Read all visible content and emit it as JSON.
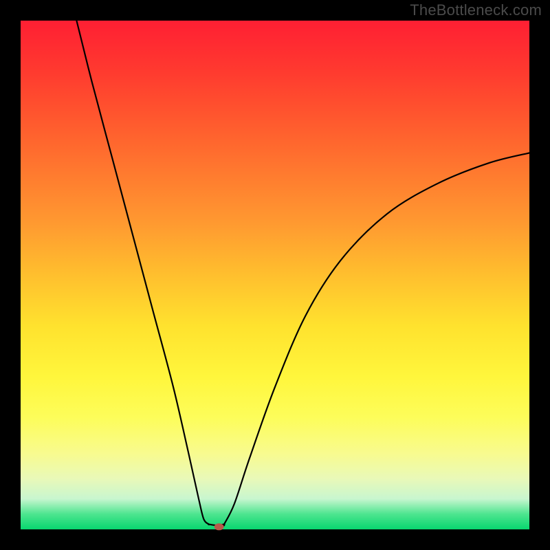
{
  "watermark": "TheBottleneck.com",
  "chart_data": {
    "type": "line",
    "title": "",
    "xlabel": "",
    "ylabel": "",
    "xlim": [
      0,
      100
    ],
    "ylim": [
      0,
      100
    ],
    "grid": false,
    "legend": false,
    "series": [
      {
        "name": "left-branch",
        "x": [
          11,
          14,
          18,
          22,
          26,
          30,
          33,
          35,
          36,
          37
        ],
        "y": [
          100,
          88,
          73,
          58,
          43,
          28,
          15,
          6,
          2,
          1
        ]
      },
      {
        "name": "valley",
        "x": [
          37,
          38.5,
          40
        ],
        "y": [
          1,
          0.8,
          1
        ]
      },
      {
        "name": "right-branch",
        "x": [
          40,
          42,
          45,
          50,
          56,
          63,
          72,
          82,
          92,
          100
        ],
        "y": [
          1,
          5,
          14,
          28,
          42,
          53,
          62,
          68,
          72,
          74
        ]
      }
    ],
    "marker": {
      "x": 39,
      "y": 0.5,
      "color": "#b85a4a"
    },
    "gradient_stops": [
      {
        "pos": 0,
        "color": "#ff1f33"
      },
      {
        "pos": 50,
        "color": "#ffbf2e"
      },
      {
        "pos": 70,
        "color": "#fff63c"
      },
      {
        "pos": 100,
        "color": "#08d66f"
      }
    ]
  }
}
